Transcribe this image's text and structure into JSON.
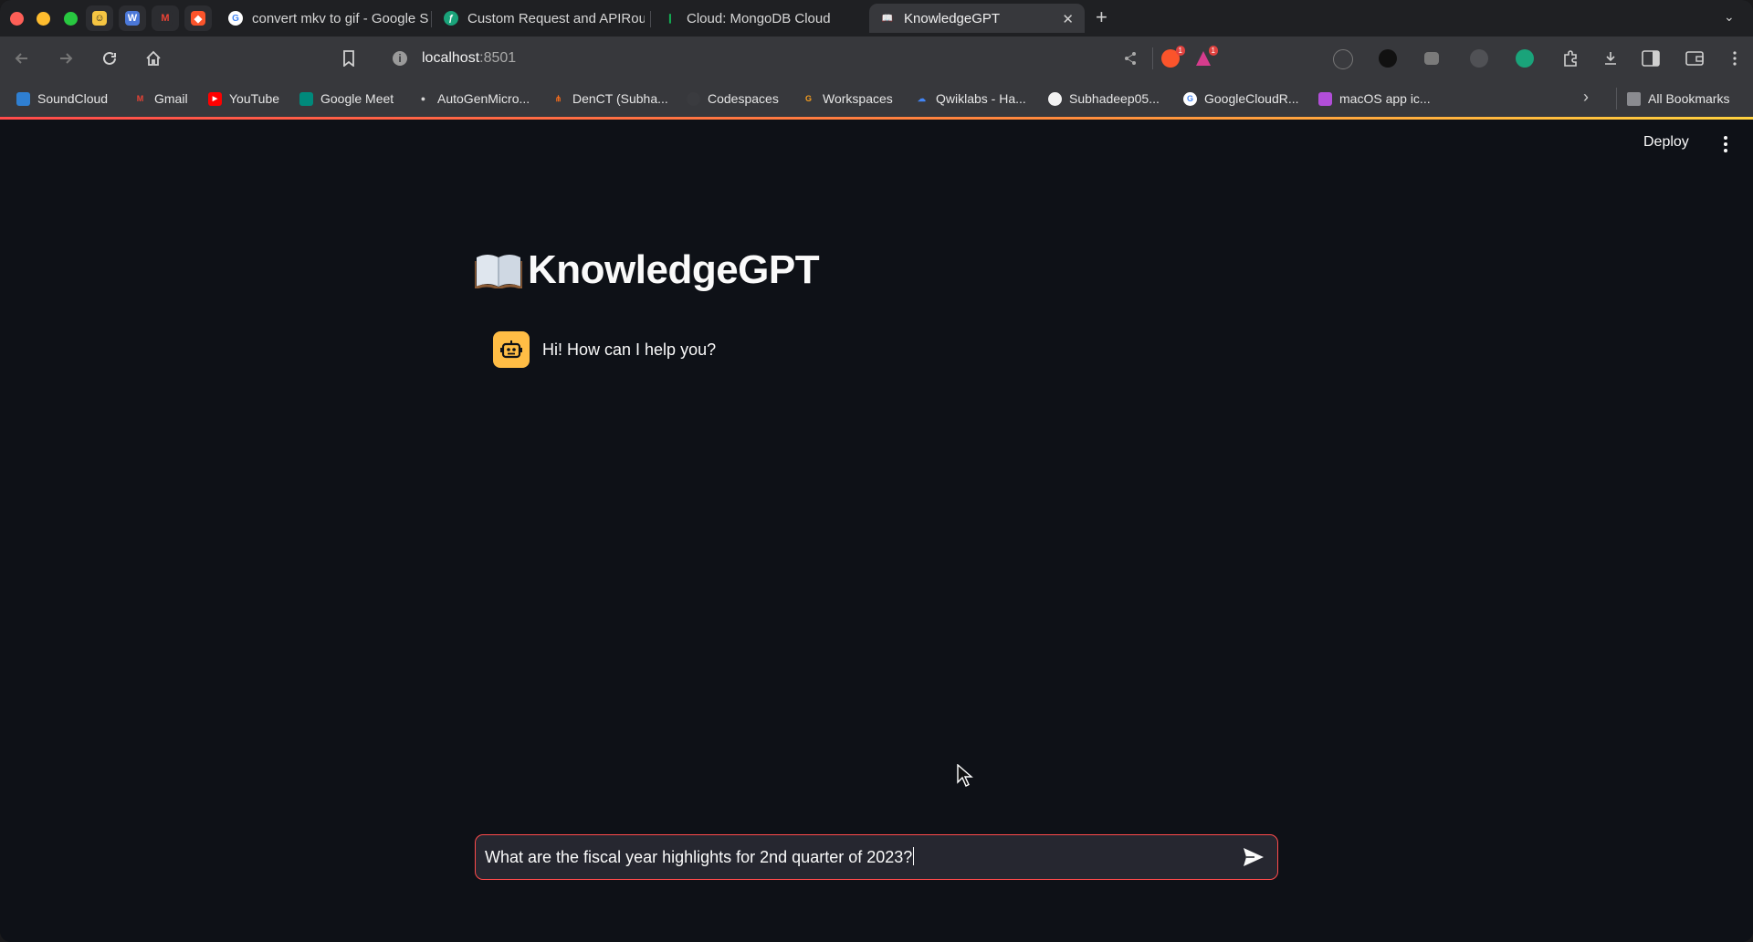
{
  "browser": {
    "pinned_tabs": [
      "chat-ext",
      "docs",
      "gmail",
      "brave-shield"
    ],
    "tabs": [
      {
        "title": "convert mkv to gif - Google S",
        "icon": "google-icon"
      },
      {
        "title": "Custom Request and APIRou",
        "icon": "api-icon"
      },
      {
        "title": "Cloud: MongoDB Cloud",
        "icon": "mongodb-icon"
      },
      {
        "title": "KnowledgeGPT",
        "icon": "book-icon",
        "active": true
      }
    ],
    "url_host": "localhost",
    "url_port": ":8501",
    "shields_badge": "1",
    "alert_badge": "1",
    "bookmarks": [
      {
        "label": "SoundCloud",
        "color": "#2f7fd1"
      },
      {
        "label": "Gmail",
        "color": "#ea4335"
      },
      {
        "label": "YouTube",
        "color": "#ff0000"
      },
      {
        "label": "Google Meet",
        "color": "#00897b"
      },
      {
        "label": "AutoGenMicro...",
        "color": "#d6d6d6"
      },
      {
        "label": "DenCT (Subha...",
        "color": "#f26b1d"
      },
      {
        "label": "Codespaces",
        "color": "#3a3b3f"
      },
      {
        "label": "Workspaces",
        "color": "#f49d1f"
      },
      {
        "label": "Qwiklabs - Ha...",
        "color": "#4285f4"
      },
      {
        "label": "Subhadeep05...",
        "color": "#f2f2f2"
      },
      {
        "label": "GoogleCloudR...",
        "color": "#4285f4"
      },
      {
        "label": "macOS app ic...",
        "color": "#b14ed8"
      }
    ],
    "all_bookmarks": "All Bookmarks"
  },
  "app": {
    "deploy_label": "Deploy",
    "title": "KnowledgeGPT",
    "assistant_message": "Hi! How can I help you?",
    "chat_input_value": "What are the fiscal year highlights for 2nd quarter of 2023?",
    "accent": "#ff4b4b",
    "avatar_color": "#ffbd45"
  }
}
